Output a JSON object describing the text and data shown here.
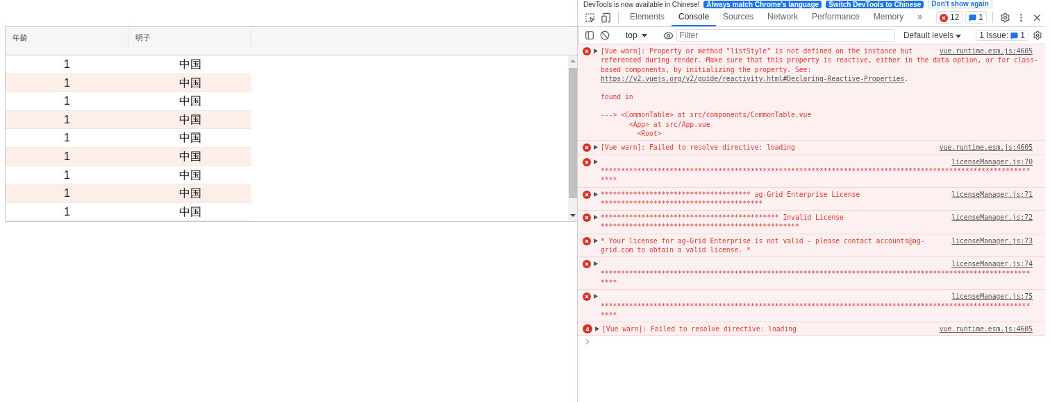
{
  "table": {
    "columns": [
      "年龄",
      "明子"
    ],
    "rows": [
      {
        "age": "1",
        "name": "中国"
      },
      {
        "age": "1",
        "name": "中国"
      },
      {
        "age": "1",
        "name": "中国"
      },
      {
        "age": "1",
        "name": "中国"
      },
      {
        "age": "1",
        "name": "中国"
      },
      {
        "age": "1",
        "name": "中国"
      },
      {
        "age": "1",
        "name": "中国"
      },
      {
        "age": "1",
        "name": "中国"
      },
      {
        "age": "1",
        "name": "中国"
      }
    ]
  },
  "devtools": {
    "banner": {
      "text": "DevTools is now available in Chinese!",
      "buttons": [
        {
          "label": "Always match Chrome's language",
          "kind": "primary"
        },
        {
          "label": "Switch DevTools to Chinese",
          "kind": "primary"
        },
        {
          "label": "Don't show again",
          "kind": "plain"
        }
      ]
    },
    "tabs": [
      {
        "label": "Elements",
        "selected": false
      },
      {
        "label": "Console",
        "selected": true
      },
      {
        "label": "Sources",
        "selected": false
      },
      {
        "label": "Network",
        "selected": false
      },
      {
        "label": "Performance",
        "selected": false
      },
      {
        "label": "Memory",
        "selected": false
      }
    ],
    "more_tabs": "»",
    "error_count": "12",
    "message_count": "1",
    "context": "top",
    "filter": {
      "placeholder": "Filter"
    },
    "levels": "Default levels",
    "issues": {
      "label": "1 Issue:",
      "count": "1"
    },
    "messages": [
      {
        "kind": "error",
        "head": "[Vue warn]: Property or method \"listStyle\" is not defined on the instance but",
        "lines": [
          "referenced during render. Make sure that this property is reactive, either in the data option, or for class-",
          "based components, by initializing the property. See:"
        ],
        "link": "https://v2.vuejs.org/v2/guide/reactivity.html#Declaring-Reactive-Properties",
        "after": ".",
        "details": [
          "found in",
          "---> <CommonTable> at src/components/CommonTable.vue",
          "       <App> at src/App.vue",
          "         <Root>"
        ],
        "source": "vue.runtime.esm.js:4605"
      },
      {
        "kind": "error",
        "head": "[Vue warn]: Failed to resolve directive: loading",
        "source": "vue.runtime.esm.js:4605"
      },
      {
        "kind": "error",
        "lines": [
          "**********************************************************************************************************",
          "****"
        ],
        "source": "licenseManager.js:70"
      },
      {
        "kind": "error",
        "head": "************************************* ag-Grid Enterprise License",
        "lines": [
          "****************************************"
        ],
        "source": "licenseManager.js:71"
      },
      {
        "kind": "error",
        "head": "******************************************** Invalid License",
        "lines": [
          "*************************************************"
        ],
        "source": "licenseManager.js:72"
      },
      {
        "kind": "error",
        "head": "* Your license for ag-Grid Enterprise is not valid - please contact accounts@ag-",
        "lines": [
          "grid.com to obtain a valid license. *"
        ],
        "source": "licenseManager.js:73"
      },
      {
        "kind": "error",
        "lines": [
          "**********************************************************************************************************",
          "****"
        ],
        "source": "licenseManager.js:74"
      },
      {
        "kind": "error",
        "lines": [
          "**********************************************************************************************************",
          "****"
        ],
        "source": "licenseManager.js:75"
      },
      {
        "kind": "repeat",
        "count": "4",
        "head": "[Vue warn]: Failed to resolve directive: loading",
        "source": "vue.runtime.esm.js:4605"
      }
    ]
  }
}
